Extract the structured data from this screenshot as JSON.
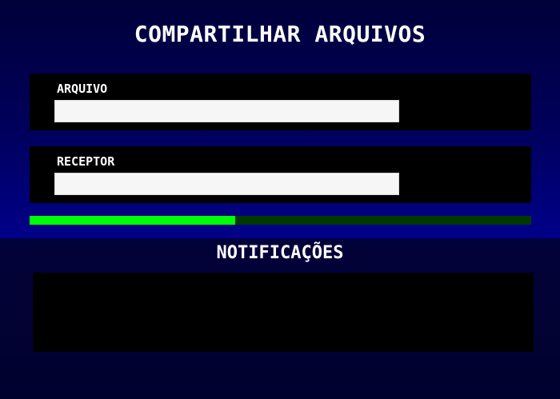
{
  "header": {
    "title": "COMPARTILHAR ARQUIVOS"
  },
  "fields": {
    "file": {
      "label": "ARQUIVO",
      "value": "",
      "placeholder": ""
    },
    "receiver": {
      "label": "RECEPTOR",
      "value": "",
      "placeholder": ""
    }
  },
  "progress": {
    "fraction": 0.41
  },
  "notifications": {
    "title": "NOTIFICAÇÕES",
    "items": []
  },
  "colors": {
    "progress_fill": "#00ff00",
    "progress_track": "#003a00",
    "panel_background": "#00005c",
    "box_background": "#000000"
  }
}
